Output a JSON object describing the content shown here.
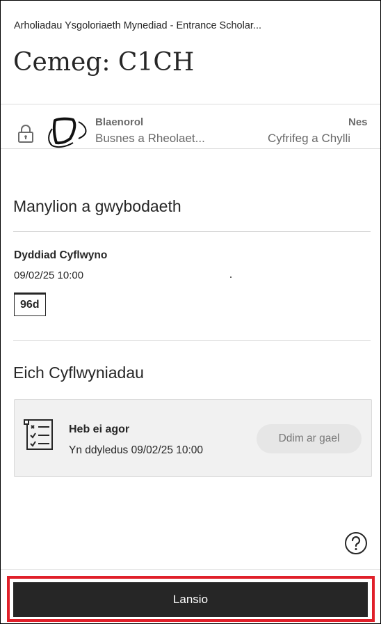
{
  "header": {
    "breadcrumb": "Arholiadau Ysgoloriaeth Mynediad - Entrance Scholar...",
    "title": "Cemeg: C1CH"
  },
  "navigation": {
    "lock_icon": "lock-icon",
    "previous": {
      "icon": "previous-item-icon",
      "kicker": "Blaenorol",
      "title": "Busnes a Rheolaet..."
    },
    "next": {
      "kicker": "Nes",
      "title": "Cyfrifeg a Chylli"
    }
  },
  "details": {
    "heading": "Manylion a gwybodaeth",
    "due_label": "Dyddiad Cyflwyno",
    "due_date": "09/02/25 10:00",
    "countdown": "96d"
  },
  "submissions": {
    "heading": "Eich Cyflwyniadau",
    "card": {
      "icon": "checklist-icon",
      "status": "Heb ei agor",
      "due": "Yn ddyledus 09/02/25 10:00",
      "availability": "Ddim ar gael"
    }
  },
  "help": {
    "icon": "help-circle-icon"
  },
  "footer": {
    "launch_label": "Lansio",
    "highlight_color": "#e0202a",
    "button_color": "#262626"
  }
}
